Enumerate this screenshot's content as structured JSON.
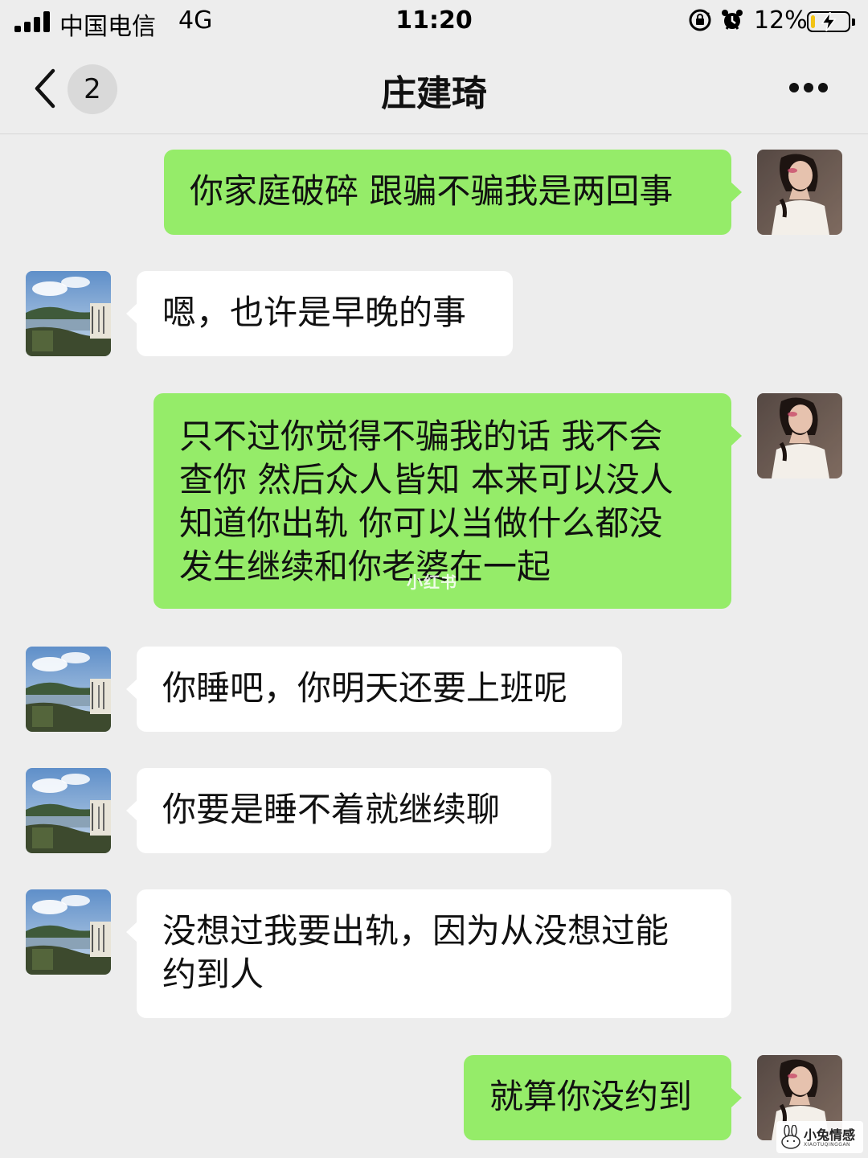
{
  "status_bar": {
    "carrier": "中国电信",
    "network": "4G",
    "time": "11:20",
    "battery_percent": "12%",
    "battery_level": 0.12,
    "battery_color": "#f2c315",
    "icons": [
      "signal-icon",
      "rotation-lock-icon",
      "alarm-icon",
      "battery-icon",
      "charging-bolt-icon"
    ]
  },
  "nav": {
    "title": "庄建琦",
    "unread_count": "2",
    "icons": [
      "back-chevron-icon",
      "more-dots-icon"
    ]
  },
  "messages": [
    {
      "side": "sent",
      "avatar": "user-avatar-woman",
      "text": "你家庭破碎 跟骗不骗我是两回事"
    },
    {
      "side": "received",
      "avatar": "contact-avatar-lake",
      "text": "嗯，也许是早晚的事"
    },
    {
      "side": "sent",
      "avatar": "user-avatar-woman",
      "lines": [
        "只不过你觉得不骗我的话 我不会",
        "查你 然后众人皆知 本来可以没人",
        "知道你出轨 你可以当做什么都没",
        "发生继续和你老婆在一起"
      ]
    },
    {
      "side": "received",
      "avatar": "contact-avatar-lake",
      "text": "你睡吧，你明天还要上班呢"
    },
    {
      "side": "received",
      "avatar": "contact-avatar-lake",
      "text": "你要是睡不着就继续聊"
    },
    {
      "side": "received",
      "avatar": "contact-avatar-lake",
      "lines": [
        "没想过我要出轨，因为从没想过能",
        "约到人"
      ]
    },
    {
      "side": "sent",
      "avatar": "user-avatar-woman",
      "text": "就算你没约到"
    }
  ],
  "watermarks": {
    "center": "小红书",
    "corner_title": "小兔情感",
    "corner_sub": "XIAOTUQINGGAN"
  },
  "colors": {
    "background": "#ededed",
    "sent_bubble": "#95ec69",
    "received_bubble": "#ffffff"
  }
}
